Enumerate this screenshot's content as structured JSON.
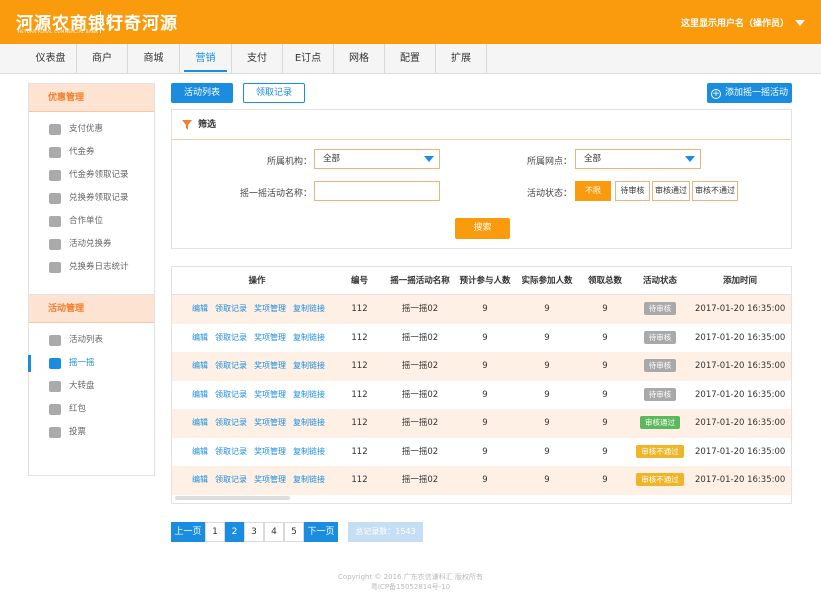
{
  "header": {
    "logo": "河源农商银行",
    "logo_sub": "HEYUAN RURAL COMMERCIAL BANK",
    "brand": "订奇河源",
    "user": "这里显示用户名（操作员）"
  },
  "nav": [
    "仪表盘",
    "商户",
    "商城",
    "营销",
    "支付",
    "E订点",
    "网格",
    "配置",
    "扩展"
  ],
  "sidebar": {
    "group1": {
      "title": "优惠管理",
      "items": [
        "支付优惠",
        "代金券",
        "代金券领取记录",
        "兑换券领取记录",
        "合作单位",
        "活动兑换券",
        "兑换券日志统计"
      ]
    },
    "group2": {
      "title": "活动管理",
      "items": [
        "活动列表",
        "摇一摇",
        "大转盘",
        "红包",
        "投票"
      ]
    }
  },
  "toolbar": {
    "tab_list": "活动列表",
    "tab_records": "领取记录",
    "add_button": "添加摇一摇活动"
  },
  "filter": {
    "title": "筛选",
    "org_label": "所属机构：",
    "org_value": "全部",
    "outlet_label": "所属网点：",
    "outlet_value": "全部",
    "name_label": "摇一摇活动名称：",
    "name_value": "",
    "status_label": "活动状态：",
    "status_options": [
      "不限",
      "待审核",
      "审核通过",
      "审核不通过"
    ],
    "search_button": "搜索"
  },
  "table": {
    "headers": [
      "操作",
      "编号",
      "摇一摇活动名称",
      "预计参与人数",
      "实际参加人数",
      "领取总数",
      "活动状态",
      "添加时间"
    ],
    "ops": [
      "编辑",
      "领取记录",
      "奖项管理",
      "复制链接"
    ],
    "rows": [
      {
        "id": "112",
        "name": "摇一摇02",
        "expected": "9",
        "actual": "9",
        "total": "9",
        "status": "待审核",
        "status_color": "#a9a9a9",
        "time": "2017-01-20 16:35:00"
      },
      {
        "id": "112",
        "name": "摇一摇02",
        "expected": "9",
        "actual": "9",
        "total": "9",
        "status": "待审核",
        "status_color": "#a9a9a9",
        "time": "2017-01-20 16:35:00"
      },
      {
        "id": "112",
        "name": "摇一摇02",
        "expected": "9",
        "actual": "9",
        "total": "9",
        "status": "待审核",
        "status_color": "#a9a9a9",
        "time": "2017-01-20 16:35:00"
      },
      {
        "id": "112",
        "name": "摇一摇02",
        "expected": "9",
        "actual": "9",
        "total": "9",
        "status": "待审核",
        "status_color": "#a9a9a9",
        "time": "2017-01-20 16:35:00"
      },
      {
        "id": "112",
        "name": "摇一摇02",
        "expected": "9",
        "actual": "9",
        "total": "9",
        "status": "审核通过",
        "status_color": "#5cb85c",
        "time": "2017-01-20 16:35:00"
      },
      {
        "id": "112",
        "name": "摇一摇02",
        "expected": "9",
        "actual": "9",
        "total": "9",
        "status": "审核不通过",
        "status_color": "#f0b429",
        "time": "2017-01-20 16:35:00"
      },
      {
        "id": "112",
        "name": "摇一摇02",
        "expected": "9",
        "actual": "9",
        "total": "9",
        "status": "审核不通过",
        "status_color": "#f0b429",
        "time": "2017-01-20 16:35:00"
      }
    ]
  },
  "pagination": {
    "prev": "上一页",
    "pages": [
      "1",
      "2",
      "3",
      "4",
      "5"
    ],
    "current": "2",
    "next": "下一页",
    "total": "总记录数：1543"
  },
  "footer": {
    "copyright": "Copyright © 2016 广东农信谦科汇 版权所有",
    "icp": "粤ICP备15052814号-10"
  },
  "colors": {
    "header": "#fa9a0d",
    "accent": "#1a8de0",
    "row_stripe": "#fff0e5"
  }
}
